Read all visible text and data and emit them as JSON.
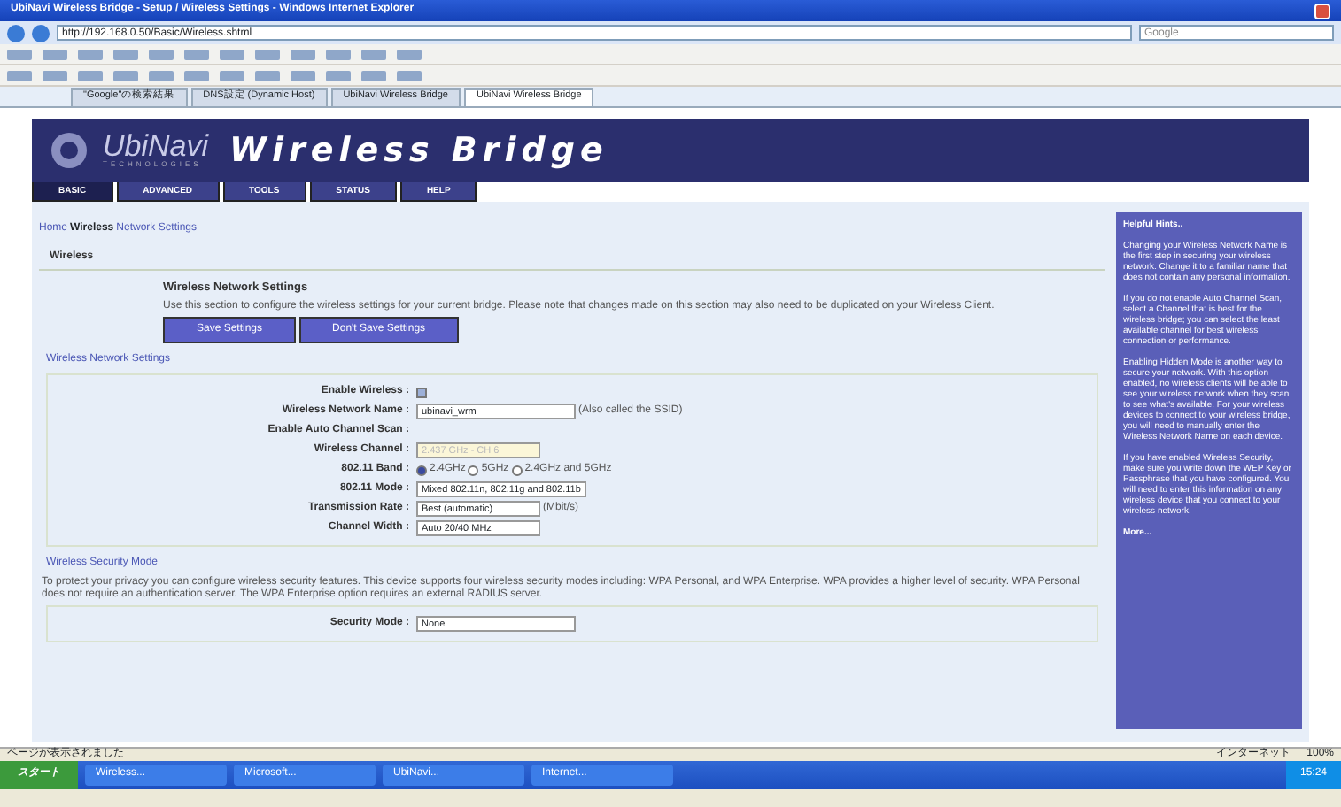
{
  "window": {
    "title": "UbiNavi Wireless Bridge - Setup / Wireless Settings - Windows Internet Explorer"
  },
  "address_bar": {
    "url": "http://192.168.0.50/Basic/Wireless.shtml",
    "search_placeholder": "Google"
  },
  "browser_tabs": [
    {
      "label": "\"Google\"の検索結果",
      "selected": false
    },
    {
      "label": "DNS設定 (Dynamic Host)",
      "selected": false
    },
    {
      "label": "UbiNavi Wireless Bridge",
      "selected": false
    },
    {
      "label": "UbiNavi Wireless Bridge",
      "selected": true
    }
  ],
  "header": {
    "brand": "UbiNavi",
    "brand_sub": "TECHNOLOGIES",
    "product": "Wireless Bridge"
  },
  "nav_tabs": [
    {
      "label": "BASIC",
      "selected": true
    },
    {
      "label": "ADVANCED",
      "selected": false
    },
    {
      "label": "TOOLS",
      "selected": false
    },
    {
      "label": "STATUS",
      "selected": false
    },
    {
      "label": "HELP",
      "selected": false
    }
  ],
  "breadcrumb": [
    "Home",
    "Wireless",
    "Network Settings"
  ],
  "section_title": "Wireless",
  "intro": {
    "title": "Wireless Network Settings",
    "text": "Use this section to configure the wireless settings for your current bridge. Please note that changes made on this section may also need to be duplicated on your Wireless Client.",
    "buttons": [
      "Save Settings",
      "Don't Save Settings"
    ]
  },
  "network_settings": {
    "title": "Wireless Network Settings",
    "rows": [
      {
        "kind": "checkbox",
        "label": "Enable Wireless :",
        "checked": true
      },
      {
        "kind": "text",
        "label": "Wireless Network Name :",
        "value": "ubinavi_wrm",
        "note": "(Also called the SSID)"
      },
      {
        "kind": "blank",
        "label": "Enable Auto Channel Scan :"
      },
      {
        "kind": "select",
        "label": "Wireless Channel :",
        "value": "2.437 GHz - CH 6",
        "disabled": true
      },
      {
        "kind": "radio",
        "label": "802.11 Band :",
        "options": [
          {
            "label": "2.4GHz",
            "selected": true
          },
          {
            "label": "5GHz",
            "selected": false
          },
          {
            "label": "2.4GHz and 5GHz",
            "selected": false
          }
        ]
      },
      {
        "kind": "select",
        "label": "802.11 Mode :",
        "value": "Mixed 802.11n, 802.11g and 802.11b",
        "disabled": false
      },
      {
        "kind": "select",
        "label": "Transmission Rate :",
        "value": "Best (automatic)",
        "note": "(Mbit/s)",
        "disabled": false
      },
      {
        "kind": "select",
        "label": "Channel Width :",
        "value": "Auto 20/40 MHz",
        "disabled": false
      }
    ]
  },
  "security": {
    "title": "Wireless Security Mode",
    "text": "To protect your privacy you can configure wireless security features. This device supports four wireless security modes including: WPA Personal, and WPA Enterprise. WPA provides a higher level of security. WPA Personal does not require an authentication server. The WPA Enterprise option requires an external RADIUS server.",
    "label": "Security Mode :",
    "value": "None"
  },
  "hints": {
    "title": "Helpful Hints..",
    "paragraphs": [
      "Changing your Wireless Network Name is the first step in securing your wireless network. Change it to a familiar name that does not contain any personal information.",
      "If you do not enable Auto Channel Scan, select a Channel that is best for the wireless bridge; you can select the least available channel for best wireless connection or performance.",
      "Enabling Hidden Mode is another way to secure your network. With this option enabled, no wireless clients will be able to see your wireless network when they scan to see what's available. For your wireless devices to connect to your wireless bridge, you will need to manually enter the Wireless Network Name on each device.",
      "If you have enabled Wireless Security, make sure you write down the WEP Key or Passphrase that you have configured. You will need to enter this information on any wireless device that you connect to your wireless network."
    ],
    "more": "More..."
  },
  "status_bar": {
    "left": "ページが表示されました",
    "zone": "インターネット",
    "zoom": "100%"
  },
  "taskbar": {
    "start": "スタート",
    "items": [
      "Wireless...",
      "Microsoft...",
      "UbiNavi...",
      "Internet..."
    ],
    "clock": "15:24"
  }
}
